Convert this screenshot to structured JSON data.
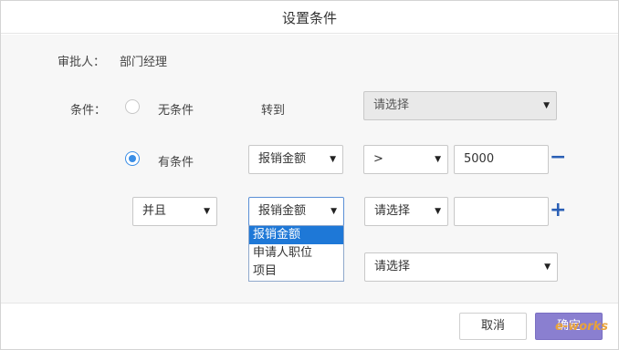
{
  "dialog": {
    "title": "设置条件",
    "approver_label": "审批人：",
    "approver_value": "部门经理",
    "condition_label": "条件：",
    "option_none": "无条件",
    "goto_label": "转到",
    "goto_select": "请选择",
    "option_has": "有条件",
    "row1": {
      "field": "报销金额",
      "operator": ">",
      "value": "5000"
    },
    "row2": {
      "logic": "并且",
      "field": "报销金额",
      "operator": "请选择",
      "value": "",
      "dropdown_options": [
        "报销金额",
        "申请人职位",
        "项目"
      ]
    },
    "row3": {
      "select": "请选择"
    },
    "minus_icon": "−",
    "plus_icon": "+",
    "caret": "▼"
  },
  "footer": {
    "cancel": "取消",
    "ok": "确定"
  },
  "watermark": "e-works"
}
